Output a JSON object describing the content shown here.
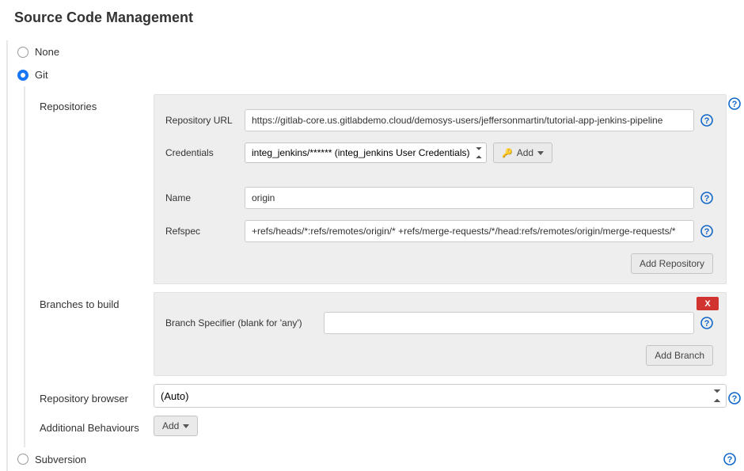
{
  "section_title": "Source Code Management",
  "scm": {
    "options": {
      "none": "None",
      "git": "Git",
      "subversion": "Subversion"
    }
  },
  "repositories": {
    "label": "Repositories",
    "url_label": "Repository URL",
    "url_value": "https://gitlab-core.us.gitlabdemo.cloud/demosys-users/jeffersonmartin/tutorial-app-jenkins-pipeline",
    "cred_label": "Credentials",
    "cred_value": "integ_jenkins/****** (integ_jenkins User Credentials)",
    "add_cred_label": "Add",
    "name_label": "Name",
    "name_value": "origin",
    "refspec_label": "Refspec",
    "refspec_value": "+refs/heads/*:refs/remotes/origin/* +refs/merge-requests/*/head:refs/remotes/origin/merge-requests/*",
    "add_repo_btn": "Add Repository"
  },
  "branches": {
    "label": "Branches to build",
    "spec_label": "Branch Specifier (blank for 'any')",
    "spec_value": "",
    "delete_label": "X",
    "add_branch_btn": "Add Branch"
  },
  "repo_browser": {
    "label": "Repository browser",
    "value": "(Auto)"
  },
  "additional": {
    "label": "Additional Behaviours",
    "add_btn": "Add"
  }
}
